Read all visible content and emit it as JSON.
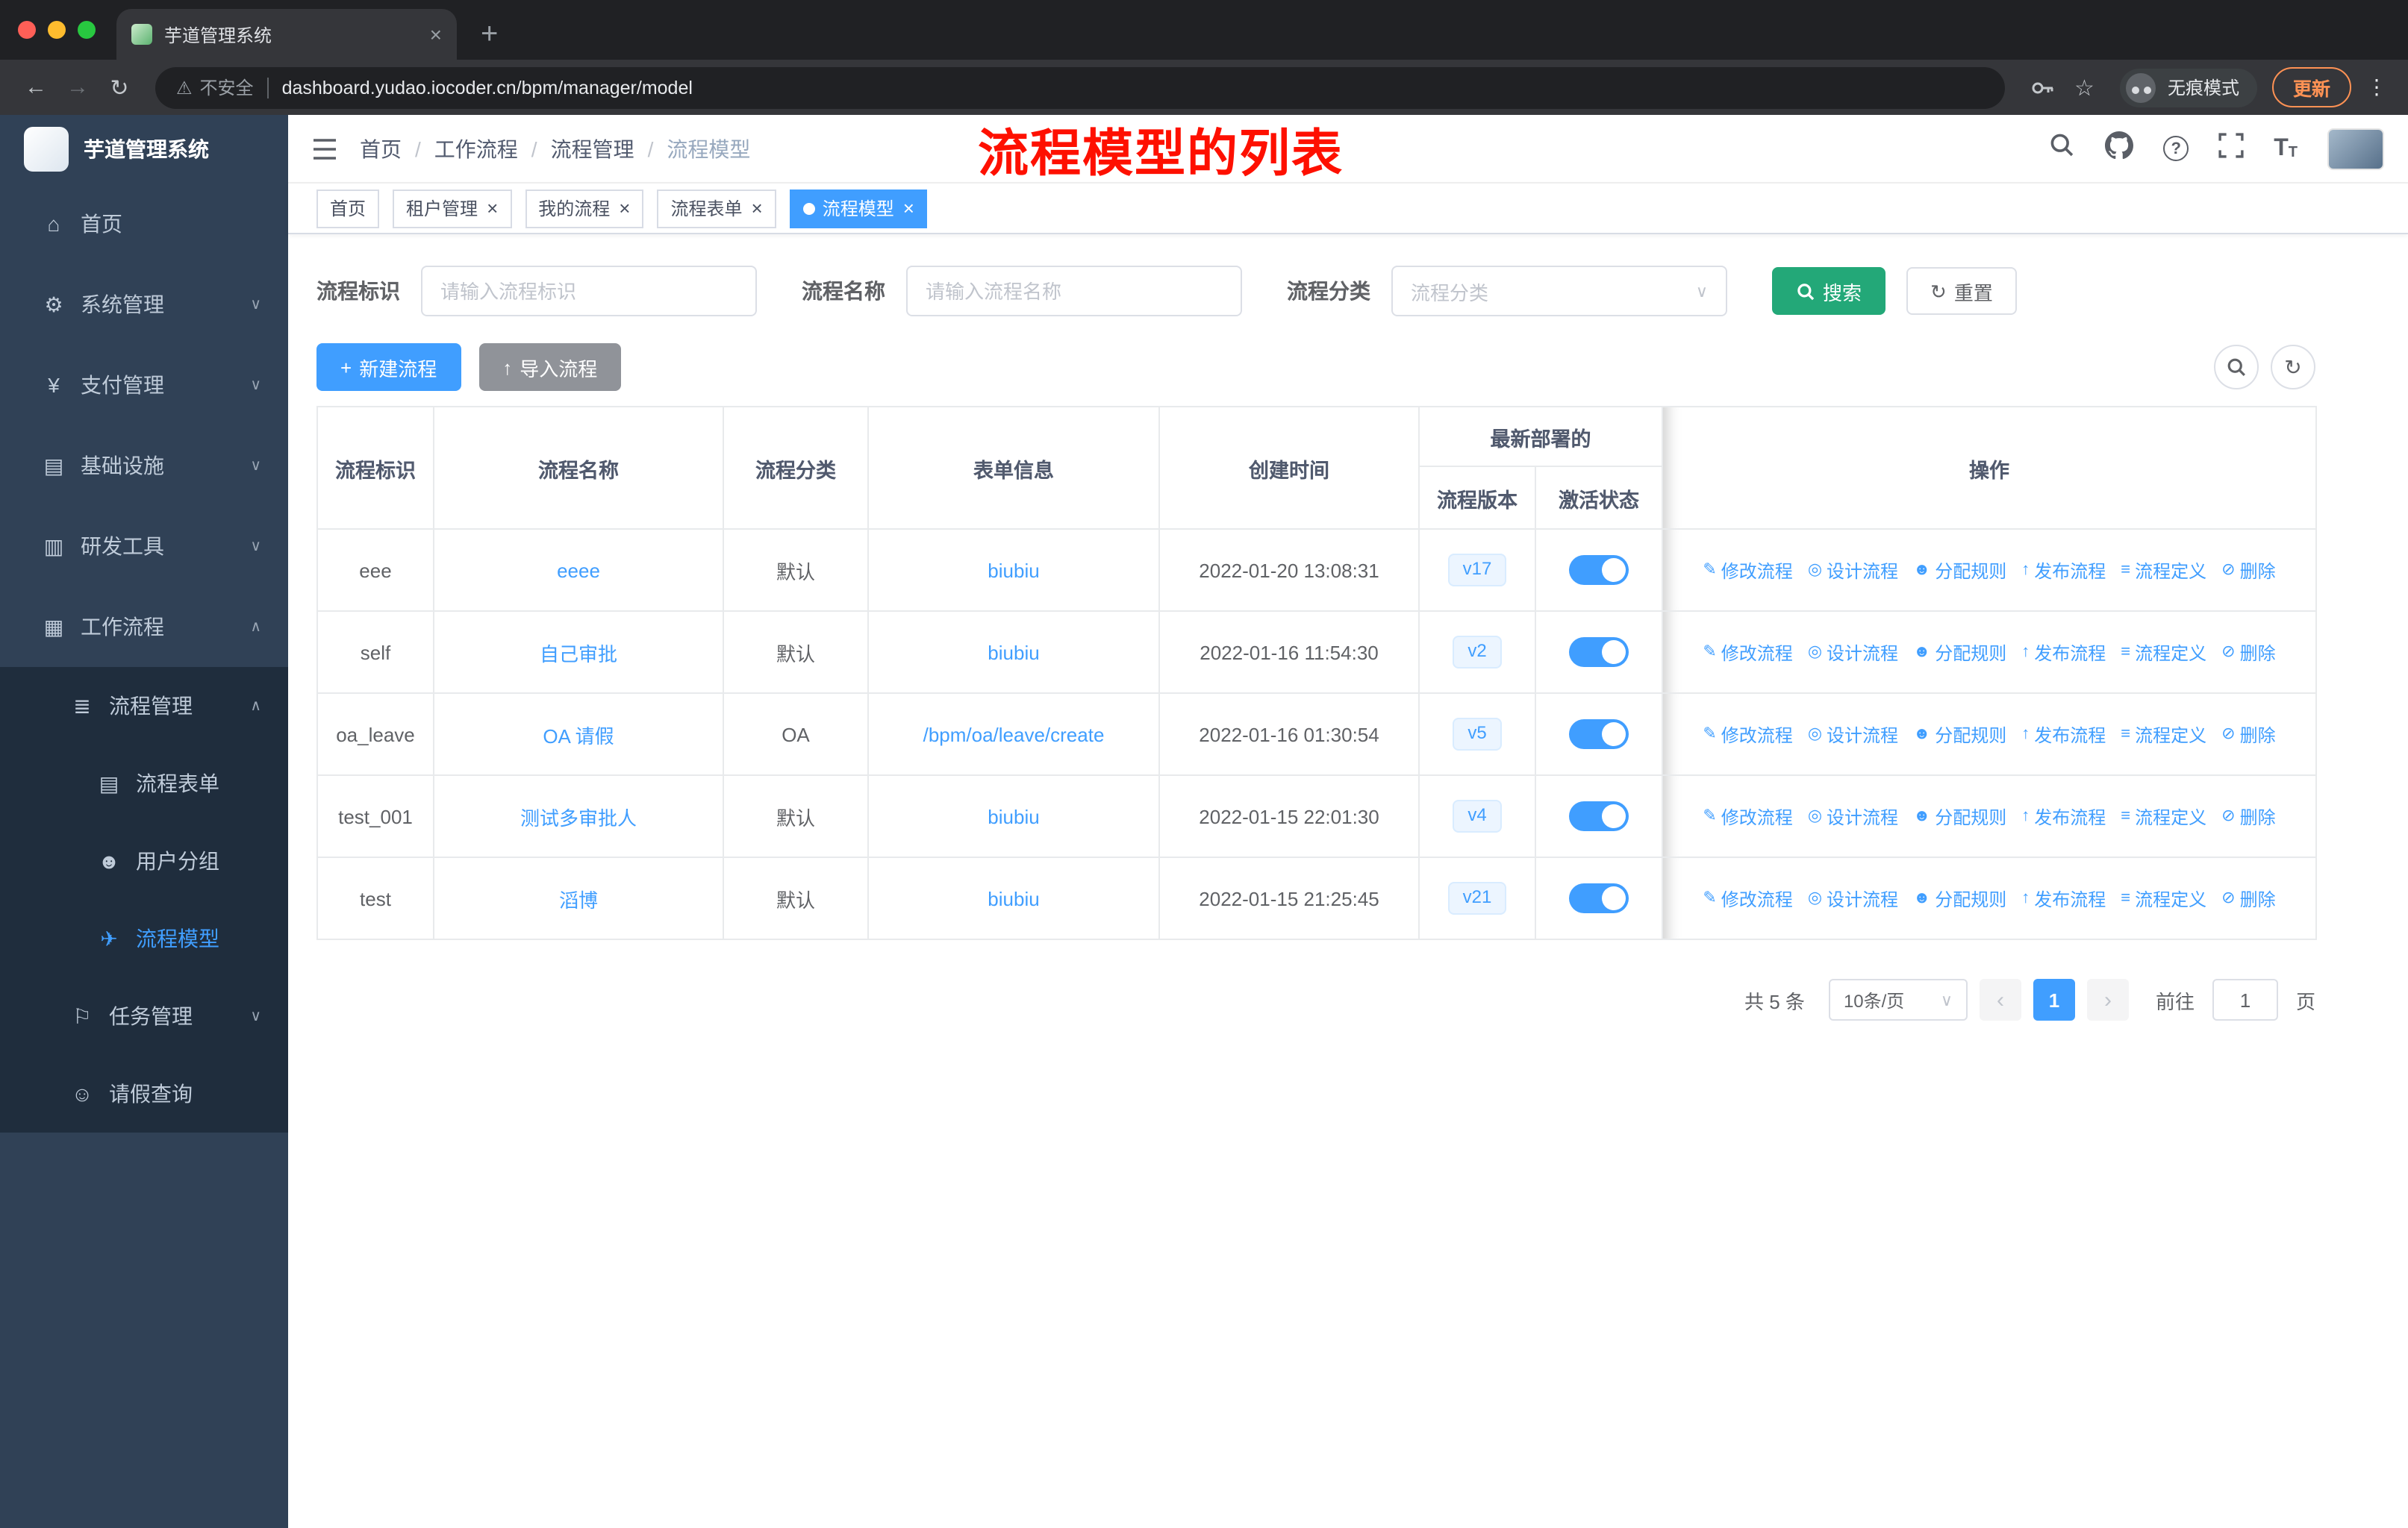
{
  "misc": {
    "close": "×",
    "plus": "+",
    "dots": "⋮",
    "back": "←",
    "forward": "→",
    "reload": "↻",
    "star": "☆",
    "warning": "⚠",
    "chevron_down": "∨",
    "question": "?",
    "upload": "↑",
    "fontsize_big": "T",
    "fontsize_small": "T"
  },
  "colors": {
    "accent": "#409eff",
    "search_button": "#23a878",
    "sidebar_bg": "#304156",
    "sidebar_sub_bg": "#1f2d3d",
    "annotation_red": "#fe1000",
    "toggle_on": "#409eff",
    "version_badge_bg": "#ecf5ff",
    "import_button": "#909399",
    "update_orange": "#ff9254"
  },
  "browser": {
    "tab_title": "芋道管理系统",
    "security": "不安全",
    "url": "dashboard.yudao.iocoder.cn/bpm/manager/model",
    "incognito": "无痕模式",
    "update": "更新"
  },
  "sidebar": {
    "title": "芋道管理系统",
    "items": [
      {
        "label": "首页",
        "glyph": "⌂",
        "level0": true
      },
      {
        "label": "系统管理",
        "glyph": "⚙",
        "level0": true,
        "chevron": "∨"
      },
      {
        "label": "支付管理",
        "glyph": "¥",
        "level0": true,
        "chevron": "∨"
      },
      {
        "label": "基础设施",
        "glyph": "▤",
        "level0": true,
        "chevron": "∨"
      },
      {
        "label": "研发工具",
        "glyph": "▥",
        "level0": true,
        "chevron": "∨"
      },
      {
        "label": "工作流程",
        "glyph": "▦",
        "level0": true,
        "chevron": "∧"
      },
      {
        "label": "流程管理",
        "glyph": "≣",
        "sub1": true,
        "chevron": "∧"
      },
      {
        "label": "流程表单",
        "glyph": "▤",
        "sub2": true
      },
      {
        "label": "用户分组",
        "glyph": "☻",
        "sub2": true
      },
      {
        "label": "流程模型",
        "glyph": "✈",
        "sub2": true,
        "active": true
      },
      {
        "label": "任务管理",
        "glyph": "⚐",
        "sub1": true,
        "chevron": "∨"
      },
      {
        "label": "请假查询",
        "glyph": "☺",
        "sub1": true
      }
    ]
  },
  "header": {
    "breadcrumb": [
      "首页",
      "工作流程",
      "流程管理",
      "流程模型"
    ],
    "annotation": "流程模型的列表"
  },
  "tags": [
    {
      "label": "首页"
    },
    {
      "label": "租户管理",
      "closable": true
    },
    {
      "label": "我的流程",
      "closable": true
    },
    {
      "label": "流程表单",
      "closable": true
    },
    {
      "label": "流程模型",
      "closable": true,
      "active": true
    }
  ],
  "filters": {
    "id_label": "流程标识",
    "id_placeholder": "请输入流程标识",
    "name_label": "流程名称",
    "name_placeholder": "请输入流程名称",
    "category_label": "流程分类",
    "category_placeholder": "流程分类",
    "search": "搜索",
    "reset": "重置"
  },
  "toolbar": {
    "create": "新建流程",
    "import": "导入流程"
  },
  "table": {
    "col_id": "流程标识",
    "col_name": "流程名称",
    "col_category": "流程分类",
    "col_form": "表单信息",
    "col_created": "创建时间",
    "group_deploy": "最新部署的",
    "col_version": "流程版本",
    "col_active": "激活状态",
    "col_actions": "操作",
    "row_actions": [
      {
        "label": "修改流程",
        "glyph": "✎"
      },
      {
        "label": "设计流程",
        "glyph": "◎"
      },
      {
        "label": "分配规则",
        "glyph": "☻"
      },
      {
        "label": "发布流程",
        "glyph": "↑"
      },
      {
        "label": "流程定义",
        "glyph": "≡"
      },
      {
        "label": "删除",
        "glyph": "⊘"
      }
    ],
    "rows": [
      {
        "id": "eee",
        "name": "eeee",
        "category": "默认",
        "form": "biubiu",
        "created": "2022-01-20 13:08:31",
        "version": "v17",
        "active": true
      },
      {
        "id": "self",
        "name": "自己审批",
        "category": "默认",
        "form": "biubiu",
        "created": "2022-01-16 11:54:30",
        "version": "v2",
        "active": true
      },
      {
        "id": "oa_leave",
        "name": "OA 请假",
        "category": "OA",
        "form": "/bpm/oa/leave/create",
        "created": "2022-01-16 01:30:54",
        "version": "v5",
        "active": true
      },
      {
        "id": "test_001",
        "name": "测试多审批人",
        "category": "默认",
        "form": "biubiu",
        "created": "2022-01-15 22:01:30",
        "version": "v4",
        "active": true
      },
      {
        "id": "test",
        "name": "滔博",
        "category": "默认",
        "form": "biubiu",
        "created": "2022-01-15 21:25:45",
        "version": "v21",
        "active": true
      }
    ]
  },
  "pagination": {
    "total": "共 5 条",
    "page_size": "10条/页",
    "prev": "‹",
    "page": "1",
    "next": "›",
    "goto": "前往",
    "goto_value": "1",
    "unit": "页"
  }
}
